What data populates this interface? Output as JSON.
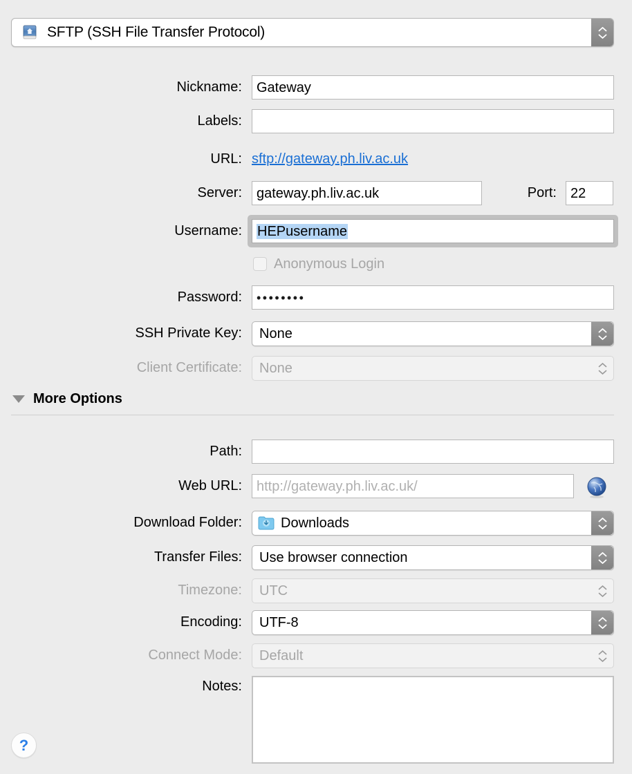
{
  "window": {
    "protocol": {
      "label": "SFTP (SSH File Transfer Protocol)",
      "icon": "sftp-disk-icon"
    }
  },
  "form": {
    "nickname": {
      "label": "Nickname:",
      "value": "Gateway",
      "placeholder": ""
    },
    "labels": {
      "label": "Labels:",
      "value": "",
      "placeholder": ""
    },
    "url": {
      "label": "URL:",
      "value": "sftp://gateway.ph.liv.ac.uk"
    },
    "server": {
      "label": "Server:",
      "value": "gateway.ph.liv.ac.uk",
      "placeholder": ""
    },
    "port": {
      "label": "Port:",
      "value": "22",
      "placeholder": ""
    },
    "username": {
      "label": "Username:",
      "value": "HEPusername",
      "placeholder": "",
      "selected": true
    },
    "anonymous": {
      "label": "Anonymous Login",
      "checked": false,
      "enabled": false
    },
    "password": {
      "label": "Password:",
      "value": "••••••••",
      "placeholder": ""
    },
    "ssh_private_key": {
      "label": "SSH Private Key:",
      "value": "None",
      "enabled": true
    },
    "client_certificate": {
      "label": "Client Certificate:",
      "value": "None",
      "enabled": false
    }
  },
  "more_options": {
    "label": "More Options",
    "expanded": true,
    "disclosure_icon": "chevron-down-icon",
    "path": {
      "label": "Path:",
      "value": "",
      "placeholder": ""
    },
    "web_url": {
      "label": "Web URL:",
      "value": "",
      "placeholder": "http://gateway.ph.liv.ac.uk/",
      "button_icon": "globe-icon"
    },
    "download_folder": {
      "label": "Download Folder:",
      "value": "Downloads",
      "icon": "downloads-folder-icon",
      "enabled": true
    },
    "transfer_files": {
      "label": "Transfer Files:",
      "value": "Use browser connection",
      "enabled": true
    },
    "timezone": {
      "label": "Timezone:",
      "value": "UTC",
      "enabled": false
    },
    "encoding": {
      "label": "Encoding:",
      "value": "UTF-8",
      "enabled": true
    },
    "connect_mode": {
      "label": "Connect Mode:",
      "value": "Default",
      "enabled": false
    },
    "notes": {
      "label": "Notes:",
      "value": "",
      "placeholder": ""
    }
  },
  "help": {
    "label": "?",
    "icon": "help-icon"
  },
  "colors": {
    "background": "#ececec",
    "link": "#1a6fd4",
    "selection": "#b4d5f5",
    "accent": "#2b7fe8",
    "disabled_text": "#a6a6a6"
  }
}
